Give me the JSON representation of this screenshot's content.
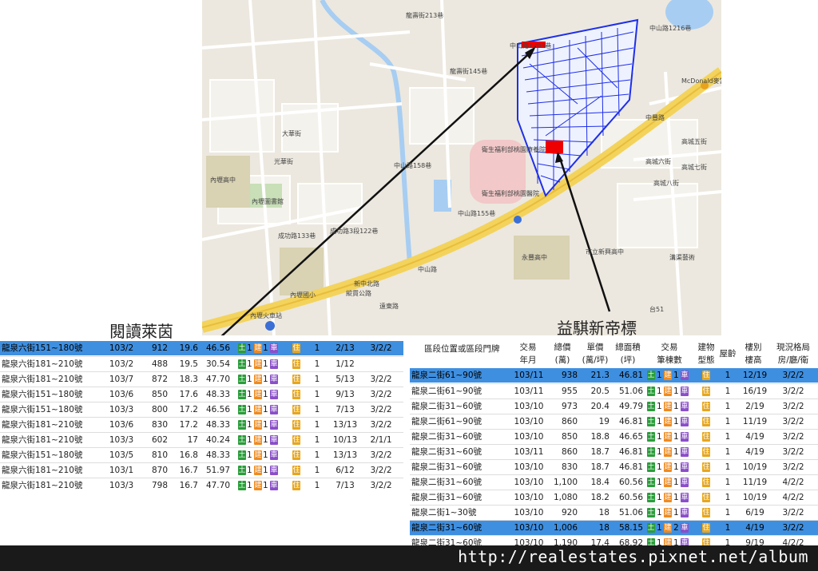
{
  "captions": {
    "left": "閱讀萊茵",
    "right": "益騏新帝標"
  },
  "footer": {
    "url": "http://realestates.pixnet.net/album"
  },
  "map": {
    "labels": {
      "l1": "龍壽街213巷",
      "l2": "中山路1216巷",
      "l3": "中山路1203巷",
      "l4": "龍壽街145巷",
      "l5": "McDonald麥當勞",
      "l6": "中豐路",
      "l7": "高城六街",
      "l8": "高城五街",
      "l9": "高城七街",
      "l10": "高城八街",
      "l11": "衛生福利部桃園療養院",
      "l12": "衛生福利部桃園醫院",
      "l13": "內壢高中",
      "l14": "內壢圖書館",
      "l15": "成功路133巷",
      "l16": "成功路3段122巷",
      "l17": "縱貫公路",
      "l18": "中山路",
      "l19": "永豐高中",
      "l20": "市立新興高中",
      "l21": "內壢火車站",
      "l22": "內壢國小",
      "l23": "遠東路",
      "l24": "台51",
      "l25": "大華街",
      "l26": "光華街",
      "l27": "中山路158巷",
      "l28": "中山路155巷",
      "l29": "新中北路",
      "l30": "溝渠藝術"
    }
  },
  "left_table": {
    "rows": [
      {
        "addr": "龍泉六街151~180號",
        "ym": "103/2",
        "total": "912",
        "unit": "19.6",
        "area": "46.56",
        "b1": "土",
        "n1": "1",
        "b2": "建",
        "n2": "1",
        "b3": "車",
        "res": "住",
        "age": "1",
        "floor": "2/13",
        "layout": "3/2/2",
        "hl": true
      },
      {
        "addr": "龍泉六街181~210號",
        "ym": "103/2",
        "total": "488",
        "unit": "19.5",
        "area": "30.54",
        "b1": "土",
        "n1": "1",
        "b2": "建",
        "n2": "1",
        "b3": "車",
        "res": "住",
        "age": "1",
        "floor": "1/12",
        "layout": "",
        "hl": false
      },
      {
        "addr": "龍泉六街181~210號",
        "ym": "103/7",
        "total": "872",
        "unit": "18.3",
        "area": "47.70",
        "b1": "土",
        "n1": "1",
        "b2": "建",
        "n2": "1",
        "b3": "車",
        "res": "住",
        "age": "1",
        "floor": "5/13",
        "layout": "3/2/2",
        "hl": false
      },
      {
        "addr": "龍泉六街151~180號",
        "ym": "103/6",
        "total": "850",
        "unit": "17.6",
        "area": "48.33",
        "b1": "土",
        "n1": "1",
        "b2": "建",
        "n2": "1",
        "b3": "車",
        "res": "住",
        "age": "1",
        "floor": "9/13",
        "layout": "3/2/2",
        "hl": false
      },
      {
        "addr": "龍泉六街151~180號",
        "ym": "103/3",
        "total": "800",
        "unit": "17.2",
        "area": "46.56",
        "b1": "土",
        "n1": "1",
        "b2": "建",
        "n2": "1",
        "b3": "車",
        "res": "住",
        "age": "1",
        "floor": "7/13",
        "layout": "3/2/2",
        "hl": false
      },
      {
        "addr": "龍泉六街181~210號",
        "ym": "103/6",
        "total": "830",
        "unit": "17.2",
        "area": "48.33",
        "b1": "土",
        "n1": "1",
        "b2": "建",
        "n2": "1",
        "b3": "車",
        "res": "住",
        "age": "1",
        "floor": "13/13",
        "layout": "3/2/2",
        "hl": false
      },
      {
        "addr": "龍泉六街181~210號",
        "ym": "103/3",
        "total": "602",
        "unit": "17",
        "area": "40.24",
        "b1": "土",
        "n1": "1",
        "b2": "建",
        "n2": "1",
        "b3": "車",
        "res": "住",
        "age": "1",
        "floor": "10/13",
        "layout": "2/1/1",
        "hl": false
      },
      {
        "addr": "龍泉六街151~180號",
        "ym": "103/5",
        "total": "810",
        "unit": "16.8",
        "area": "48.33",
        "b1": "土",
        "n1": "1",
        "b2": "建",
        "n2": "1",
        "b3": "車",
        "res": "住",
        "age": "1",
        "floor": "13/13",
        "layout": "3/2/2",
        "hl": false
      },
      {
        "addr": "龍泉六街181~210號",
        "ym": "103/1",
        "total": "870",
        "unit": "16.7",
        "area": "51.97",
        "b1": "土",
        "n1": "1",
        "b2": "建",
        "n2": "1",
        "b3": "車",
        "res": "住",
        "age": "1",
        "floor": "6/12",
        "layout": "3/2/2",
        "hl": false
      },
      {
        "addr": "龍泉六街181~210號",
        "ym": "103/3",
        "total": "798",
        "unit": "16.7",
        "area": "47.70",
        "b1": "土",
        "n1": "1",
        "b2": "建",
        "n2": "1",
        "b3": "車",
        "res": "住",
        "age": "1",
        "floor": "7/13",
        "layout": "3/2/2",
        "hl": false
      }
    ]
  },
  "right_table": {
    "headers": {
      "addr": "區段位置或區段門牌",
      "ym": [
        "交易",
        "年月"
      ],
      "total": [
        "總價",
        "(萬)"
      ],
      "unit": [
        "單價",
        "(萬/坪)"
      ],
      "area": [
        "總面積",
        "(坪)"
      ],
      "count": [
        "交易",
        "筆棟數"
      ],
      "type": [
        "建物",
        "型態"
      ],
      "age": "屋齡",
      "floor": [
        "樓別",
        "樓高"
      ],
      "layout": [
        "現況格局",
        "房/廳/衛"
      ]
    },
    "rows": [
      {
        "addr": "龍泉二街61~90號",
        "ym": "103/11",
        "total": "938",
        "unit": "21.3",
        "area": "46.81",
        "b1": "土",
        "n1": "1",
        "b2": "建",
        "n2": "1",
        "b3": "車",
        "res": "住",
        "age": "1",
        "floor": "12/19",
        "layout": "3/2/2",
        "hl": true
      },
      {
        "addr": "龍泉二街61~90號",
        "ym": "103/11",
        "total": "955",
        "unit": "20.5",
        "area": "51.06",
        "b1": "土",
        "n1": "1",
        "b2": "建",
        "n2": "1",
        "b3": "車",
        "res": "住",
        "age": "1",
        "floor": "16/19",
        "layout": "3/2/2",
        "hl": false
      },
      {
        "addr": "龍泉二街31~60號",
        "ym": "103/10",
        "total": "973",
        "unit": "20.4",
        "area": "49.79",
        "b1": "土",
        "n1": "1",
        "b2": "建",
        "n2": "1",
        "b3": "車",
        "res": "住",
        "age": "1",
        "floor": "2/19",
        "layout": "3/2/2",
        "hl": false
      },
      {
        "addr": "龍泉二街61~90號",
        "ym": "103/10",
        "total": "860",
        "unit": "19",
        "area": "46.81",
        "b1": "土",
        "n1": "1",
        "b2": "建",
        "n2": "1",
        "b3": "車",
        "res": "住",
        "age": "1",
        "floor": "11/19",
        "layout": "3/2/2",
        "hl": false
      },
      {
        "addr": "龍泉二街31~60號",
        "ym": "103/10",
        "total": "850",
        "unit": "18.8",
        "area": "46.65",
        "b1": "土",
        "n1": "1",
        "b2": "建",
        "n2": "1",
        "b3": "車",
        "res": "住",
        "age": "1",
        "floor": "4/19",
        "layout": "3/2/2",
        "hl": false
      },
      {
        "addr": "龍泉二街31~60號",
        "ym": "103/11",
        "total": "860",
        "unit": "18.7",
        "area": "46.81",
        "b1": "土",
        "n1": "1",
        "b2": "建",
        "n2": "1",
        "b3": "車",
        "res": "住",
        "age": "1",
        "floor": "4/19",
        "layout": "3/2/2",
        "hl": false
      },
      {
        "addr": "龍泉二街31~60號",
        "ym": "103/10",
        "total": "830",
        "unit": "18.7",
        "area": "46.81",
        "b1": "土",
        "n1": "1",
        "b2": "建",
        "n2": "1",
        "b3": "車",
        "res": "住",
        "age": "1",
        "floor": "10/19",
        "layout": "3/2/2",
        "hl": false
      },
      {
        "addr": "龍泉二街31~60號",
        "ym": "103/10",
        "total": "1,100",
        "unit": "18.4",
        "area": "60.56",
        "b1": "土",
        "n1": "1",
        "b2": "建",
        "n2": "1",
        "b3": "車",
        "res": "住",
        "age": "1",
        "floor": "11/19",
        "layout": "4/2/2",
        "hl": false
      },
      {
        "addr": "龍泉二街31~60號",
        "ym": "103/10",
        "total": "1,080",
        "unit": "18.2",
        "area": "60.56",
        "b1": "土",
        "n1": "1",
        "b2": "建",
        "n2": "1",
        "b3": "車",
        "res": "住",
        "age": "1",
        "floor": "10/19",
        "layout": "4/2/2",
        "hl": false
      },
      {
        "addr": "龍泉二街1~30號",
        "ym": "103/10",
        "total": "920",
        "unit": "18",
        "area": "51.06",
        "b1": "土",
        "n1": "1",
        "b2": "建",
        "n2": "1",
        "b3": "車",
        "res": "住",
        "age": "1",
        "floor": "6/19",
        "layout": "3/2/2",
        "hl": false
      },
      {
        "addr": "龍泉二街31~60號",
        "ym": "103/10",
        "total": "1,006",
        "unit": "18",
        "area": "58.15",
        "b1": "土",
        "n1": "1",
        "b2": "建",
        "n2": "2",
        "b3": "車",
        "res": "住",
        "age": "1",
        "floor": "4/19",
        "layout": "3/2/2",
        "hl": true
      },
      {
        "addr": "龍泉二街31~60號",
        "ym": "103/10",
        "total": "1,190",
        "unit": "17.4",
        "area": "68.92",
        "b1": "土",
        "n1": "1",
        "b2": "建",
        "n2": "1",
        "b3": "車",
        "res": "住",
        "age": "1",
        "floor": "9/19",
        "layout": "4/2/2",
        "hl": false
      }
    ]
  }
}
